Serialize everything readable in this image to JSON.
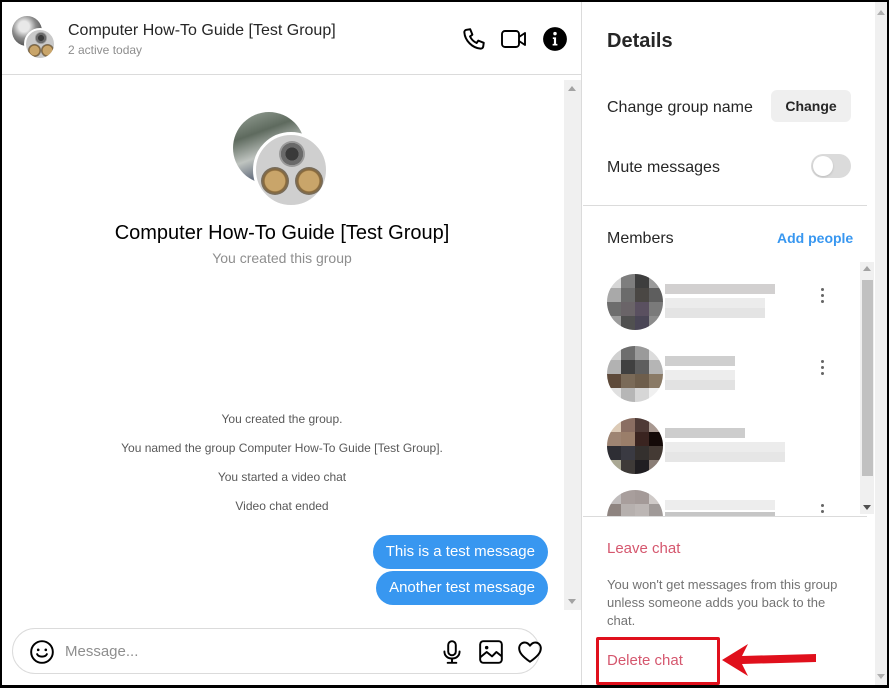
{
  "chat": {
    "header": {
      "title": "Computer How-To Guide [Test Group]",
      "subtitle": "2 active today",
      "icons": [
        "phone-icon",
        "video-camera-icon",
        "info-icon"
      ]
    },
    "intro": {
      "group_name": "Computer How-To Guide [Test Group]",
      "subtitle": "You created this group"
    },
    "system_messages": [
      "You created the group.",
      "You named the group Computer How-To Guide [Test Group].",
      "You started a video chat",
      "Video chat ended"
    ],
    "messages": [
      {
        "text": "This is a test message",
        "sender": "me"
      },
      {
        "text": "Another test message",
        "sender": "me"
      }
    ],
    "composer": {
      "placeholder": "Message...",
      "value": "",
      "icons": [
        "emoji-icon",
        "microphone-icon",
        "image-icon",
        "heart-icon"
      ]
    }
  },
  "details": {
    "title": "Details",
    "change_group_name_label": "Change group name",
    "change_button": "Change",
    "mute_label": "Mute messages",
    "mute_enabled": false,
    "members_title": "Members",
    "add_people": "Add people",
    "members": [
      {
        "name": "[blurred]",
        "username": "[blurred]"
      },
      {
        "name": "[blurred]",
        "username": "[blurred]"
      },
      {
        "name": "[blurred]",
        "username": "[blurred]"
      },
      {
        "name": "[blurred]",
        "username": "[blurred]"
      }
    ],
    "leave_chat": "Leave chat",
    "leave_note": "You won't get messages from this group unless someone adds you back to the chat.",
    "delete_chat": "Delete chat"
  },
  "annotation": {
    "target": "Delete chat",
    "color": "#e0101c"
  },
  "colors": {
    "accent_blue": "#3897f0",
    "danger_red": "#d5576e",
    "border": "#dbdbdb"
  }
}
